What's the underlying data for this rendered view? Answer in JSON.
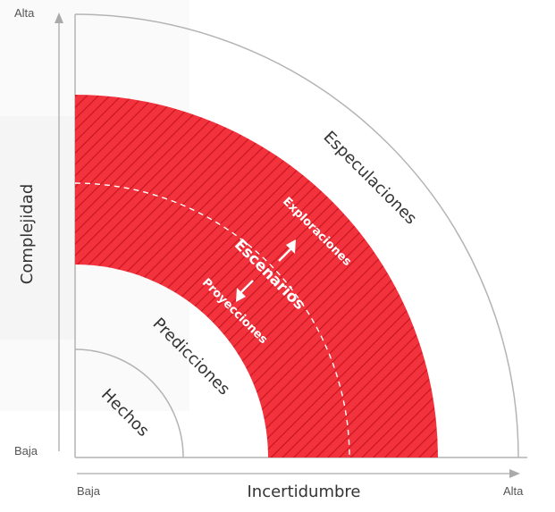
{
  "axes": {
    "y_title": "Complejidad",
    "y_high": "Alta",
    "y_low": "Baja",
    "x_title": "Incertidumbre",
    "x_low": "Baja",
    "x_high": "Alta"
  },
  "zones": {
    "hechos": "Hechos",
    "predicciones": "Predicciones",
    "escenarios": "Escenarios",
    "proyecciones": "Proyecciones",
    "exploraciones": "Exploraciones",
    "especulaciones": "Especulaciones"
  },
  "colors": {
    "scenario_band": "#f2323c",
    "hatch": "#c8141e",
    "arc": "#b4b4b4",
    "axis": "#aaaaaa"
  }
}
